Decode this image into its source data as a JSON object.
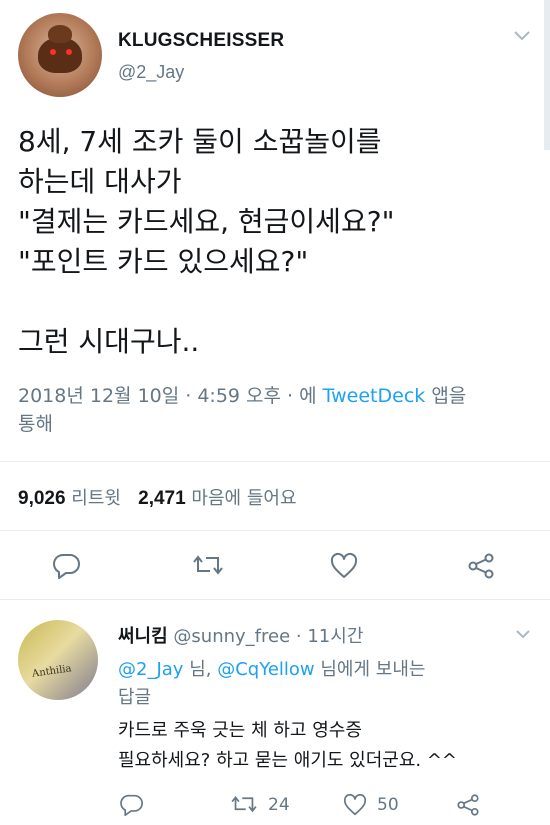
{
  "tweet": {
    "display_name": "KLUGSCHEISSER",
    "handle": "@2_Jay",
    "text_lines": [
      "8세, 7세 조카 둘이 소꿉놀이를",
      "하는데 대사가",
      "\"결제는 카드세요, 현금이세요?\"",
      "\"포인트 카드 있으세요?\""
    ],
    "text_last_line": "그런 시대구나..",
    "meta_prefix": "2018년 12월 10일 · 4:59 오후 · 에",
    "meta_link": "TweetDeck",
    "meta_suffix_1": "앱을",
    "meta_suffix_2": "통해",
    "retweet_count": "9,026",
    "retweet_label": "리트윗",
    "like_count": "2,471",
    "like_label": "마음에 들어요"
  },
  "reply": {
    "name": "써니킴",
    "handle": "@sunny_free",
    "time": "· 11시간",
    "to_mention_1": "@2_Jay",
    "to_mid": "님,",
    "to_mention_2": "@CqYellow",
    "to_suffix": "님에게 보내는",
    "to_line2": "답글",
    "text_line_1": "카드로 주욱 긋는 체 하고 영수증",
    "text_line_2": "필요하세요? 하고 묻는 애기도 있더군요. ^^",
    "retweet_count": "24",
    "like_count": "50",
    "avatar_text": "Anthilia"
  },
  "colors": {
    "text": "#14171a",
    "secondary": "#657786",
    "link": "#1da1f2",
    "divider": "#e6ecf0"
  }
}
